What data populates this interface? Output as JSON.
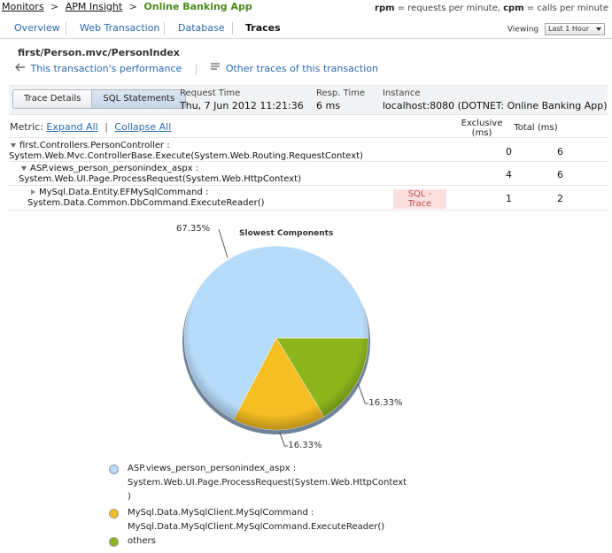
{
  "breadcrumb": {
    "items": [
      "Monitors",
      "APM Insight"
    ],
    "separator": ">",
    "current": "Online Banking App"
  },
  "rate_legend": {
    "rpm_key": "rpm",
    "rpm_text": "= requests per minute,",
    "cpm_key": "cpm",
    "cpm_text": "= calls per minute"
  },
  "tabs": [
    {
      "label": "Overview",
      "active": false
    },
    {
      "label": "Web Transaction",
      "active": false
    },
    {
      "label": "Database",
      "active": false
    },
    {
      "label": "Traces",
      "active": true
    }
  ],
  "viewing": {
    "label": "Viewing",
    "selected": "Last 1 Hour"
  },
  "transaction_path": "first/Person.mvc/PersonIndex",
  "sublinks": {
    "performance": "This transaction's performance",
    "other_traces": "Other traces of this transaction"
  },
  "segment": {
    "trace_details": "Trace Details",
    "sql_statements": "SQL Statements",
    "selected": "SQL Statements"
  },
  "request_time": {
    "label": "Request Time",
    "value": "Thu, 7 Jun 2012 11:21:36"
  },
  "resp_time": {
    "label": "Resp. Time",
    "value": "6 ms"
  },
  "instance": {
    "label": "Instance",
    "value": "localhost:8080 (DOTNET: Online Banking App)"
  },
  "metric": {
    "label": "Metric:",
    "expand": "Expand All",
    "sep": "|",
    "collapse": "Collapse All"
  },
  "columns": {
    "exclusive_1": "Exclusive",
    "exclusive_2": "(ms)",
    "total": "Total (ms)"
  },
  "rows": [
    {
      "line1": "first.Controllers.PersonController :",
      "line2": "System.Web.Mvc.ControllerBase.Execute(System.Web.Routing.RequestContext)",
      "exclusive": "0",
      "total": "6",
      "expanded": true
    },
    {
      "line1": "ASP.views_person_personindex_aspx :",
      "line2": "System.Web.UI.Page.ProcessRequest(System.Web.HttpContext)",
      "exclusive": "4",
      "total": "6",
      "expanded": true
    },
    {
      "line1": "MySql.Data.Entity.EFMySqlCommand :",
      "line2": "System.Data.Common.DbCommand.ExecuteReader()",
      "exclusive": "1",
      "total": "2",
      "expanded": false,
      "badge_1": "SQL -",
      "badge_2": "Trace"
    }
  ],
  "chart_data": {
    "type": "pie",
    "title": "Slowest Components",
    "slices": [
      {
        "label": "ASP.views_person_personindex_aspx : System.Web.UI.Page.ProcessRequest(System.Web.HttpContext)",
        "value": 67.35,
        "value_label": "67.35%",
        "color": "#b7dcfa"
      },
      {
        "label": "MySql.Data.MySqlClient.MySqlCommand : MySql.Data.MySqlClient.MySqlCommand.ExecuteReader()",
        "value": 16.33,
        "value_label": "16.33%",
        "color": "#f5be22"
      },
      {
        "label": "others",
        "value": 16.33,
        "value_label": "16.33%",
        "color": "#8cb61c"
      }
    ]
  },
  "legend": [
    {
      "line1": "ASP.views_person_personindex_aspx :",
      "line2": "System.Web.UI.Page.ProcessRequest(System.Web.HttpContext",
      "line3": ")",
      "color": "#b7dcfa"
    },
    {
      "line1": "MySql.Data.MySqlClient.MySqlCommand :",
      "line2": "MySql.Data.MySqlClient.MySqlCommand.ExecuteReader()",
      "color": "#f5be22"
    },
    {
      "line1": "others",
      "color": "#8cb61c"
    }
  ],
  "icons": {
    "back": "back-arrow-icon",
    "list": "list-icon",
    "tree_down": "triangle-down-icon",
    "tree_right": "triangle-right-icon"
  }
}
